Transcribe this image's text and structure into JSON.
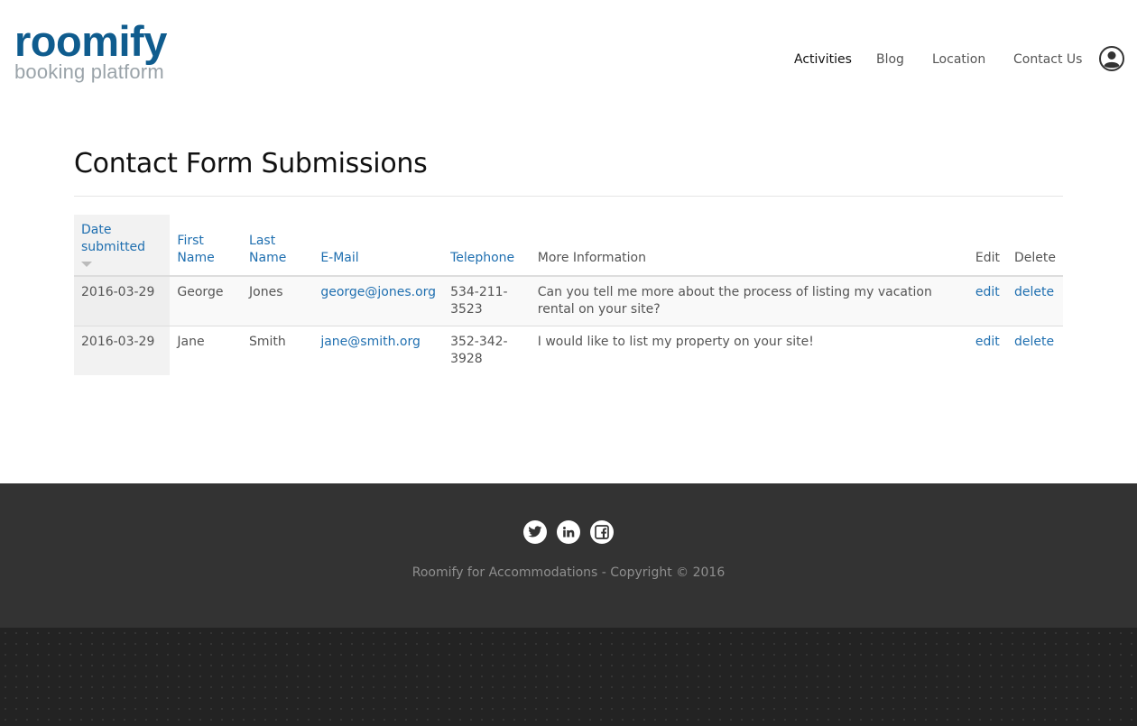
{
  "brand": {
    "name": "roomify",
    "tagline": "booking platform",
    "color": "#0f5c8e"
  },
  "nav": {
    "items": [
      {
        "label": "Activities",
        "active": true
      },
      {
        "label": "Blog",
        "active": false
      },
      {
        "label": "Location",
        "active": false
      },
      {
        "label": "Contact Us",
        "active": false
      }
    ],
    "user_icon": "user-circle-icon"
  },
  "page": {
    "title": "Contact Form Submissions"
  },
  "table": {
    "headers": {
      "date": "Date submitted",
      "first_name": "First Name",
      "last_name": "Last Name",
      "email": "E-Mail",
      "telephone": "Telephone",
      "more_info": "More Information",
      "edit": "Edit",
      "delete": "Delete"
    },
    "sort": {
      "column": "date",
      "direction": "desc"
    },
    "rows": [
      {
        "date": "2016-03-29",
        "first_name": "George",
        "last_name": "Jones",
        "email": "george@jones.org",
        "telephone": "534-211-3523",
        "more_info": "Can you tell me more about the process of listing my vacation rental on your site?",
        "edit": "edit",
        "delete": "delete"
      },
      {
        "date": "2016-03-29",
        "first_name": "Jane",
        "last_name": "Smith",
        "email": "jane@smith.org",
        "telephone": "352-342-3928",
        "more_info": "I would like to list my property on your site!",
        "edit": "edit",
        "delete": "delete"
      }
    ]
  },
  "footer": {
    "social": [
      "twitter-icon",
      "linkedin-icon",
      "facebook-icon"
    ],
    "copyright": "Roomify for Accommodations - Copyright © 2016"
  }
}
